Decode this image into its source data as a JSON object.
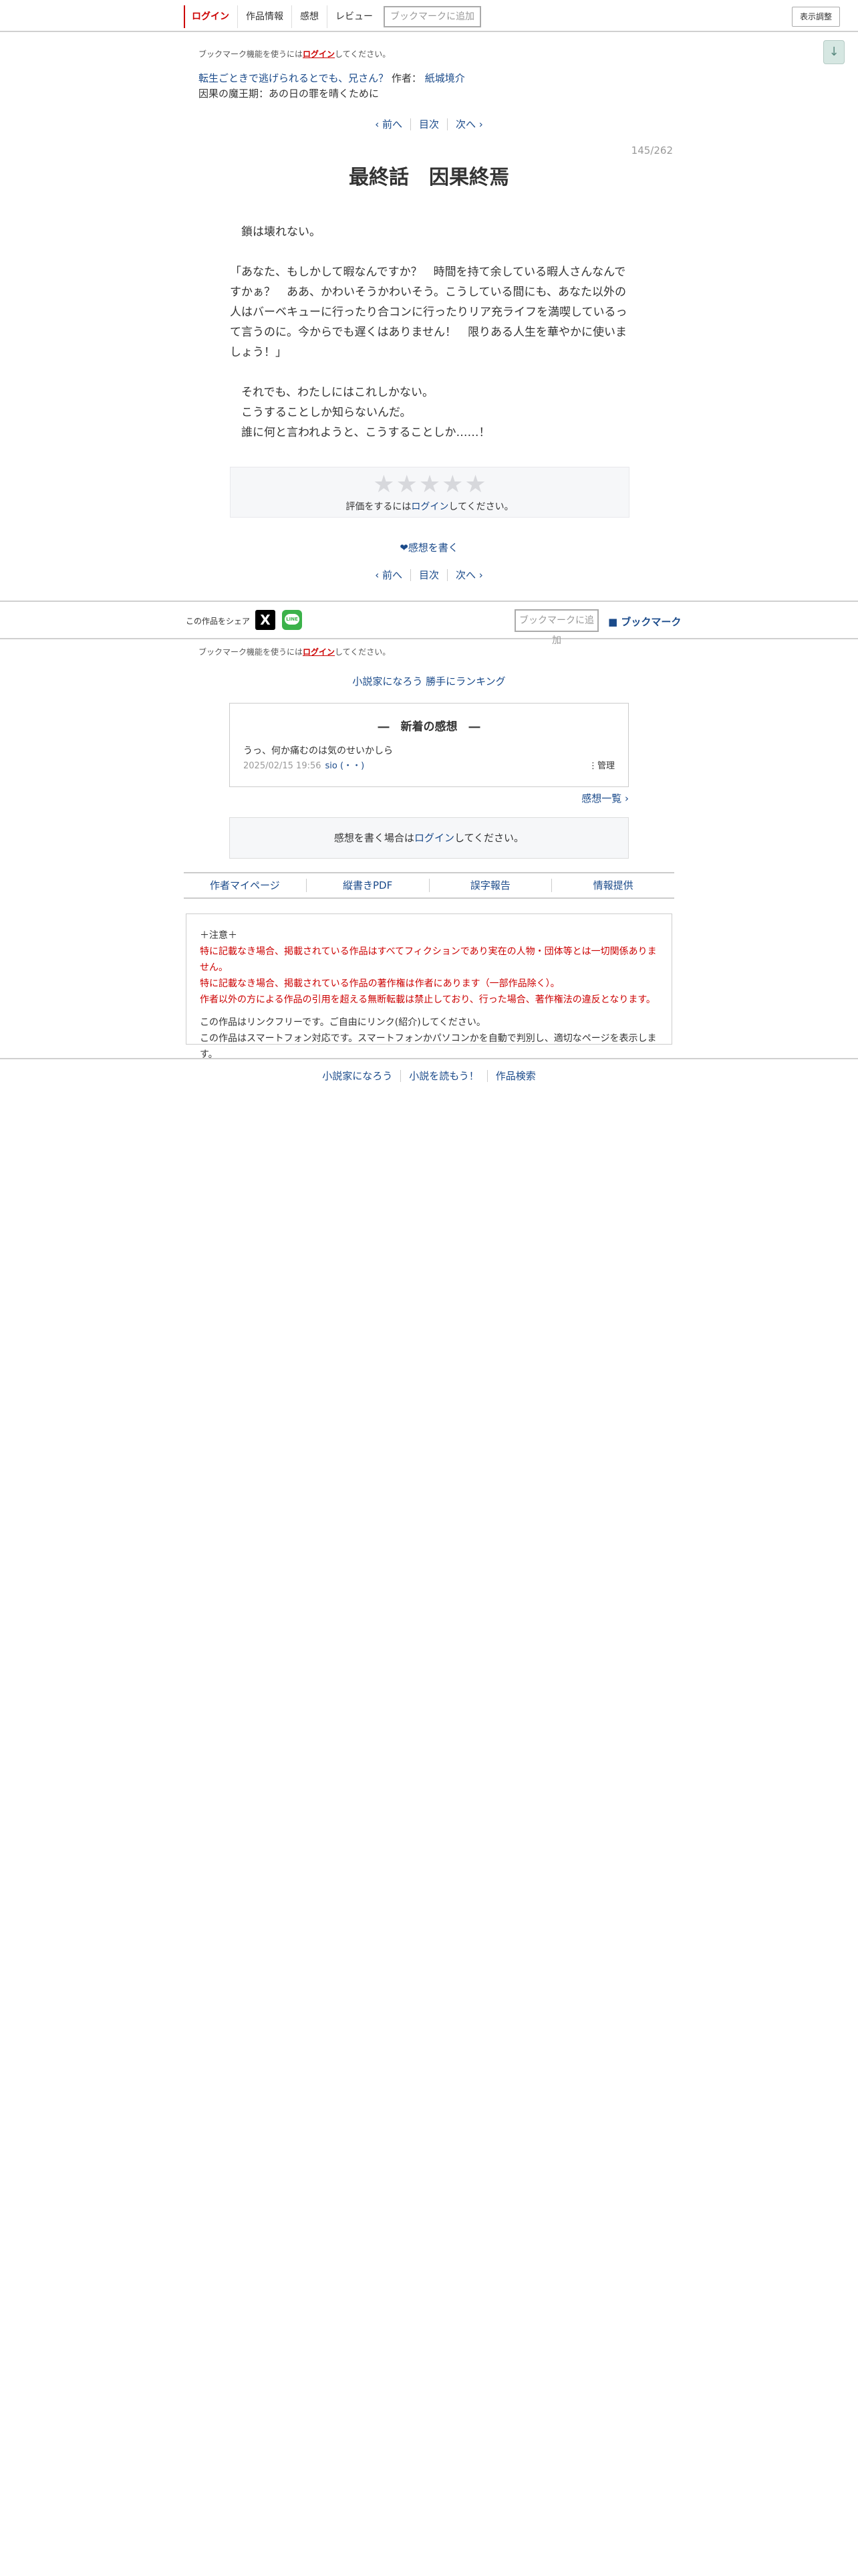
{
  "header": {
    "login": "ログイン",
    "work_info": "作品情報",
    "impressions": "感想",
    "review": "レビュー",
    "add_bookmark": "ブックマークに追加",
    "display_settings": "表示調整",
    "scroll_down": "↓"
  },
  "bookmark_notice": {
    "before": "ブックマーク機能を使うには",
    "login": "ログイン",
    "after": "してください。"
  },
  "series": {
    "title": "転生ごときで逃げられるとでも、兄さん？",
    "author_label": "作者：",
    "author": "紙城境介",
    "chapter": "因果の魔王期：あの日の罪を晴くために"
  },
  "pager": {
    "prev": "‹ 前へ",
    "toc": "目次",
    "next": "次へ ›"
  },
  "episode": {
    "page_number": "145/262",
    "title": "最終話　因果終焉"
  },
  "body": [
    "　鎖は壊れない。",
    "",
    "「あなた、もしかして暇なんですか？　時間を持て余している暇人さんなんですかぁ？　ああ、かわいそうかわいそう。こうしている間にも、あなた以外の人はバーベキューに行ったり合コンに行ったりリア充ライフを満喫しているって言うのに。今からでも遅くはありません！　限りある人生を華やかに使いましょう！」",
    "",
    "　それでも、わたしにはこれしかない。",
    "　こうすることしか知らないんだ。",
    "　誰に何と言われようと、こうすることしか……！"
  ],
  "rating": {
    "stars": [
      "★",
      "★",
      "★",
      "★",
      "★"
    ],
    "before": "評価をするには",
    "login": "ログイン",
    "after": "してください。"
  },
  "write_review": "❤感想を書く",
  "share": {
    "label": "この作品をシェア",
    "x_icon": "X",
    "line_icon": "LINE",
    "add_bookmark": "ブックマークに追加",
    "bookmark": "■ ブックマーク"
  },
  "ranking": "小説家になろう 勝手にランキング",
  "latest_review": {
    "heading": "―　新着の感想　―",
    "text": "うっ、何か痛むのは気のせいかしら",
    "date": "2025/02/15 19:56",
    "author": "sio (・・)",
    "manage": "⋮管理"
  },
  "review_list": "感想一覧 ›",
  "review_login": {
    "before": "感想を書く場合は",
    "login": "ログイン",
    "after": "してください。"
  },
  "footer_links": [
    "作者マイページ",
    "縦書きPDF",
    "誤字報告",
    "情報提供"
  ],
  "notice": {
    "heading": "＋注意＋",
    "red_lines": [
      "特に記載なき場合、掲載されている作品はすべてフィクションであり実在の人物・団体等とは一切関係ありません。",
      "特に記載なき場合、掲載されている作品の著作権は作者にあります（一部作品除く）。",
      "作者以外の方による作品の引用を超える無断転載は禁止しており、行った場合、著作権法の違反となります。"
    ],
    "lines": [
      "この作品はリンクフリーです。ご自由にリンク(紹介)してください。",
      "この作品はスマートフォン対応です。スマートフォンかパソコンかを自動で判別し、適切なページを表示します。"
    ]
  },
  "bottom_links": [
    "小説家になろう",
    "小説を読もう！",
    "作品検索"
  ]
}
